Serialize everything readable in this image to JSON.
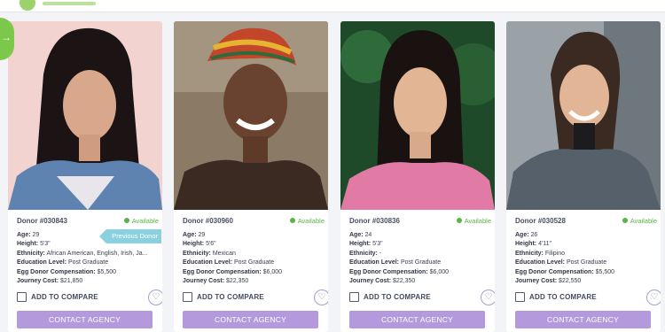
{
  "side_tab_icon": "arrow-right-icon",
  "side_tab_glyph": "→",
  "previous_donor_label": "Previous Donor",
  "labels": {
    "age": "Age:",
    "height": "Height:",
    "ethnicity": "Ethnicity:",
    "education": "Education Level:",
    "compensation": "Egg Donor Compensation:",
    "journey": "Journey Cost:",
    "compare": "ADD TO COMPARE",
    "contact": "CONTACT AGENCY"
  },
  "colors": {
    "available": "#5ab347",
    "contact_button": "#b599dd",
    "accent_green": "#7cc84a"
  },
  "donors": [
    {
      "id": "Donor #030843",
      "status": "Available",
      "age": "29",
      "height": "5'3\"",
      "ethnicity": "African American, English, Irish, Ja...",
      "education": "Post Graduate",
      "compensation": "$5,500",
      "journey": "$21,850"
    },
    {
      "id": "Donor #030960",
      "status": "Available",
      "age": "29",
      "height": "5'6\"",
      "ethnicity": "Mexican",
      "education": "Post Graduate",
      "compensation": "$6,000",
      "journey": "$22,350"
    },
    {
      "id": "Donor #030836",
      "status": "Available",
      "age": "24",
      "height": "5'3\"",
      "ethnicity": "-",
      "education": "Post Graduate",
      "compensation": "$6,000",
      "journey": "$22,350"
    },
    {
      "id": "Donor #030528",
      "status": "Available",
      "age": "26",
      "height": "4'11\"",
      "ethnicity": "Filipino",
      "education": "Post Graduate",
      "compensation": "$5,500",
      "journey": "$22,550"
    }
  ]
}
